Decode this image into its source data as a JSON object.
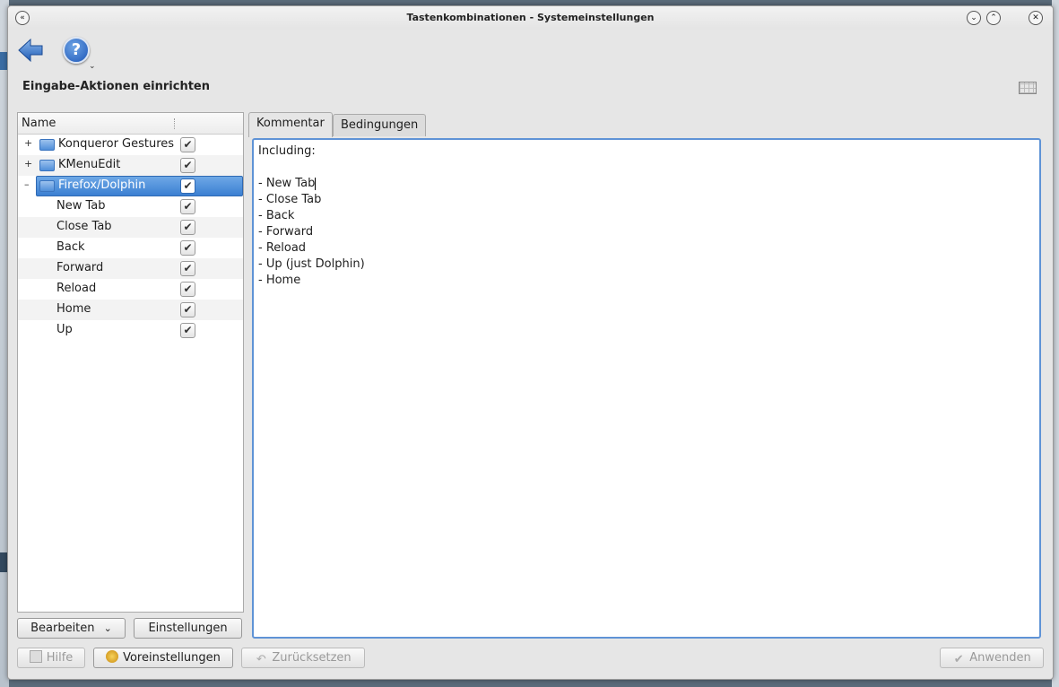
{
  "window": {
    "title": "Tastenkombinationen - Systemeinstellungen"
  },
  "page": {
    "title": "Eingabe-Aktionen einrichten"
  },
  "tree": {
    "header": "Name",
    "groups": [
      {
        "label": "Konqueror Gestures",
        "expander": "+",
        "checked": "✔"
      },
      {
        "label": "KMenuEdit",
        "expander": "+",
        "checked": "✔"
      },
      {
        "label": "Firefox/Dolphin",
        "expander": "–",
        "checked": "✔"
      }
    ],
    "items": [
      {
        "label": "New Tab",
        "checked": "✔"
      },
      {
        "label": "Close Tab",
        "checked": "✔"
      },
      {
        "label": "Back",
        "checked": "✔"
      },
      {
        "label": "Forward",
        "checked": "✔"
      },
      {
        "label": "Reload",
        "checked": "✔"
      },
      {
        "label": "Home",
        "checked": "✔"
      },
      {
        "label": "Up",
        "checked": "✔"
      }
    ],
    "edit_button": "Bearbeiten",
    "settings_button": "Einstellungen"
  },
  "tabs": [
    {
      "label": "Kommentar"
    },
    {
      "label": "Bedingungen"
    }
  ],
  "comment": {
    "lines": [
      "Including:",
      "",
      "- New Tab",
      "- Close Tab",
      "- Back",
      "- Forward",
      "- Reload",
      "- Up (just Dolphin)",
      "- Home"
    ]
  },
  "footer": {
    "help": "Hilfe",
    "defaults": "Voreinstellungen",
    "reset": "Zurücksetzen",
    "apply": "Anwenden"
  },
  "icons": {
    "help": "?",
    "dropdown": "⌄",
    "window_menu": "«",
    "minimize": "⌄",
    "maximize": "⌃",
    "close": "✕",
    "bearbeiten_arrow": "⌄"
  },
  "colors": {
    "selection": "#3b7fd2",
    "accent_border": "#5f93d6",
    "folder": "#4f8fd9"
  }
}
